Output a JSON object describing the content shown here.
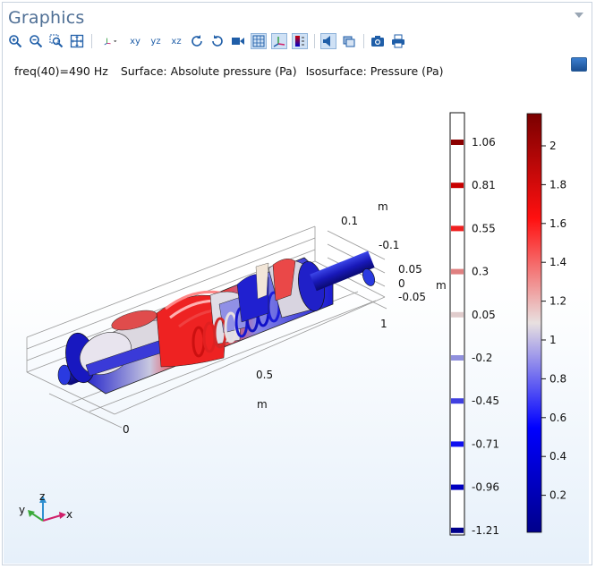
{
  "panel": {
    "title": "Graphics"
  },
  "toolbar": {
    "buttons": [
      {
        "name": "zoom-in-icon"
      },
      {
        "name": "zoom-out-icon"
      },
      {
        "name": "zoom-box-icon"
      },
      {
        "name": "zoom-extents-icon"
      },
      {
        "name": "axis-orientation-icon"
      },
      {
        "name": "view-xy-icon",
        "label": "xy"
      },
      {
        "name": "view-yz-icon",
        "label": "yz"
      },
      {
        "name": "view-xz-icon",
        "label": "xz"
      },
      {
        "name": "rotate-icon"
      },
      {
        "name": "reset-rotate-icon"
      },
      {
        "name": "camera-view-icon"
      },
      {
        "name": "grid-toggle-icon"
      },
      {
        "name": "axis-toggle-icon"
      },
      {
        "name": "color-legend-icon"
      },
      {
        "name": "scene-light-icon"
      },
      {
        "name": "transparency-icon"
      },
      {
        "name": "screenshot-icon"
      },
      {
        "name": "print-icon"
      }
    ]
  },
  "plot": {
    "info": {
      "freq": "freq(40)=490 Hz",
      "surface": "Surface: Absolute pressure (Pa)",
      "isosurface": "Isosurface: Pressure (Pa)"
    },
    "axes": {
      "x_ticks": [
        "0",
        "0.5",
        "1"
      ],
      "x_unit": "m",
      "y_ticks": [
        "0.1",
        "-0.1"
      ],
      "y_unit": "m",
      "z_ticks": [
        "0.05",
        "0",
        "-0.05"
      ],
      "z_unit": "m",
      "triad": {
        "x": "x",
        "y": "y",
        "z": "z"
      }
    },
    "legend_isosurface": {
      "colors": [
        "#8b0000",
        "#c80000",
        "#f02020",
        "#e08080",
        "#e0cccc",
        "#9090dd",
        "#4040e0",
        "#1010f0",
        "#0000c0",
        "#00008b"
      ],
      "labels": [
        "1.06",
        "0.81",
        "0.55",
        "0.3",
        "0.05",
        "-0.2",
        "-0.45",
        "-0.71",
        "-0.96",
        "-1.21"
      ]
    },
    "legend_surface": {
      "labels": [
        "2",
        "1.8",
        "1.6",
        "1.4",
        "1.2",
        "1",
        "0.8",
        "0.6",
        "0.4",
        "0.2"
      ]
    }
  }
}
